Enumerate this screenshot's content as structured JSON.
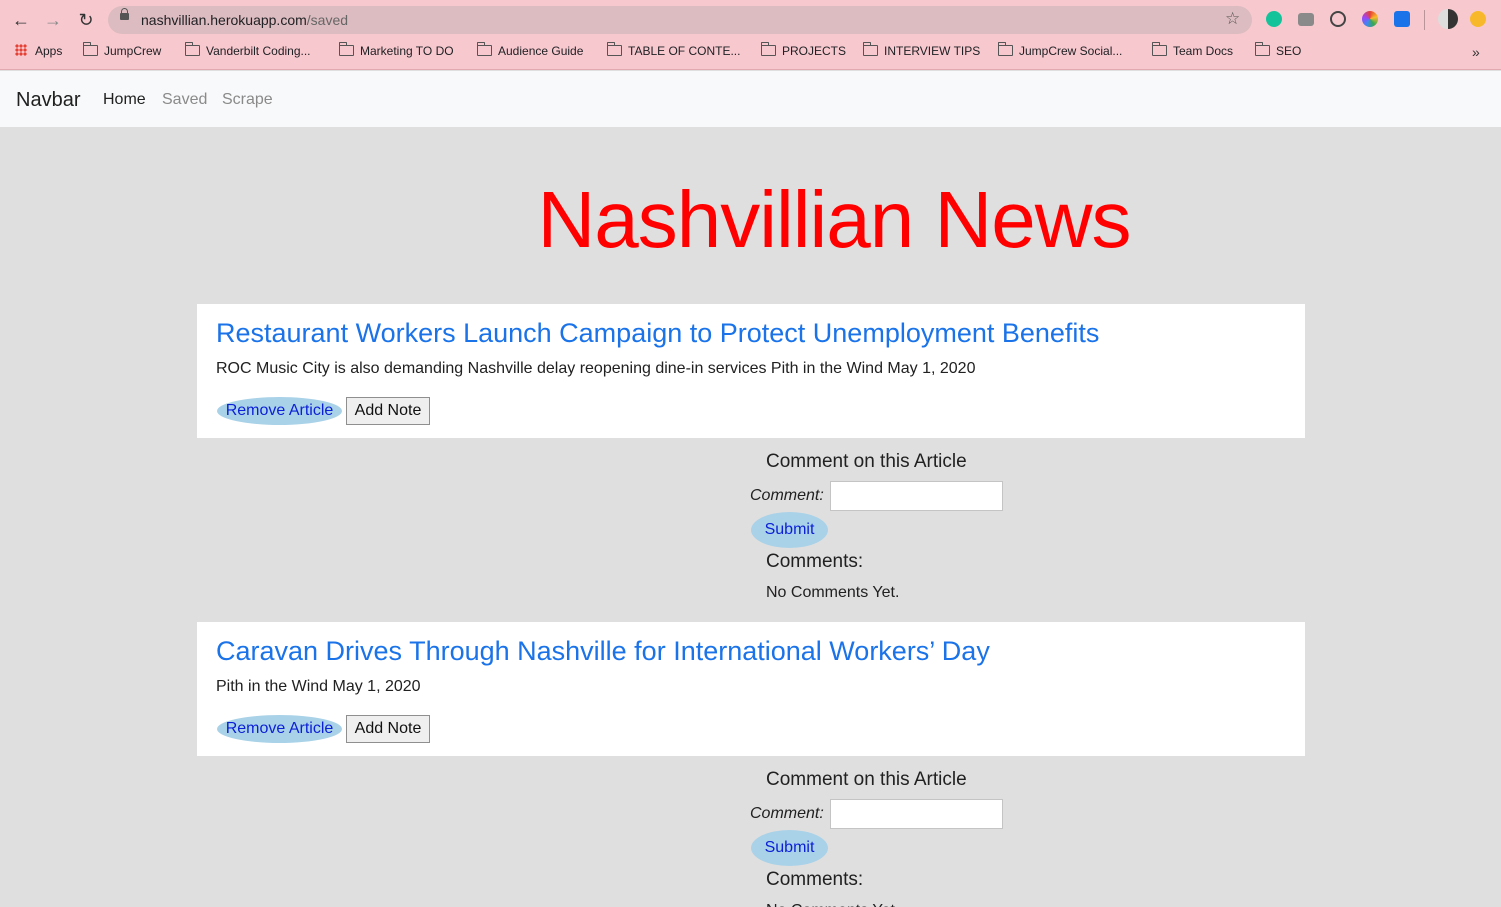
{
  "browser": {
    "url_host": "nashvillian.herokuapp.com",
    "url_path": "/saved",
    "bookmarks": [
      "Apps",
      "JumpCrew",
      "Vanderbilt Coding...",
      "Marketing TO DO",
      "Audience Guide",
      "TABLE OF CONTE...",
      "PROJECTS",
      "INTERVIEW TIPS",
      "JumpCrew Social...",
      "Team Docs",
      "SEO"
    ],
    "bookmarks_overflow": "»"
  },
  "navbar": {
    "brand": "Navbar",
    "links": [
      "Home",
      "Saved",
      "Scrape"
    ]
  },
  "headline": "Nashvillian News",
  "articles": [
    {
      "title": "Restaurant Workers Launch Campaign to Protect Unemployment Benefits",
      "summary": "ROC Music City is also demanding Nashville delay reopening dine-in services Pith in the Wind May 1, 2020",
      "remove_label": "Remove Article",
      "note_label": "Add Note"
    },
    {
      "title": "Caravan Drives Through Nashville for International Workers’ Day",
      "summary": "Pith in the Wind May 1, 2020",
      "remove_label": "Remove Article",
      "note_label": "Add Note"
    }
  ],
  "comment_form": {
    "title": "Comment on this Article",
    "label": "Comment:",
    "submit": "Submit",
    "comments_heading": "Comments:",
    "no_comments": "No Comments Yet."
  },
  "colors": {
    "headline": "#ff0000",
    "article_link": "#1a73e8",
    "pill_button_bg": "#a9d2e8",
    "chrome_bg": "#f7c9cf"
  }
}
